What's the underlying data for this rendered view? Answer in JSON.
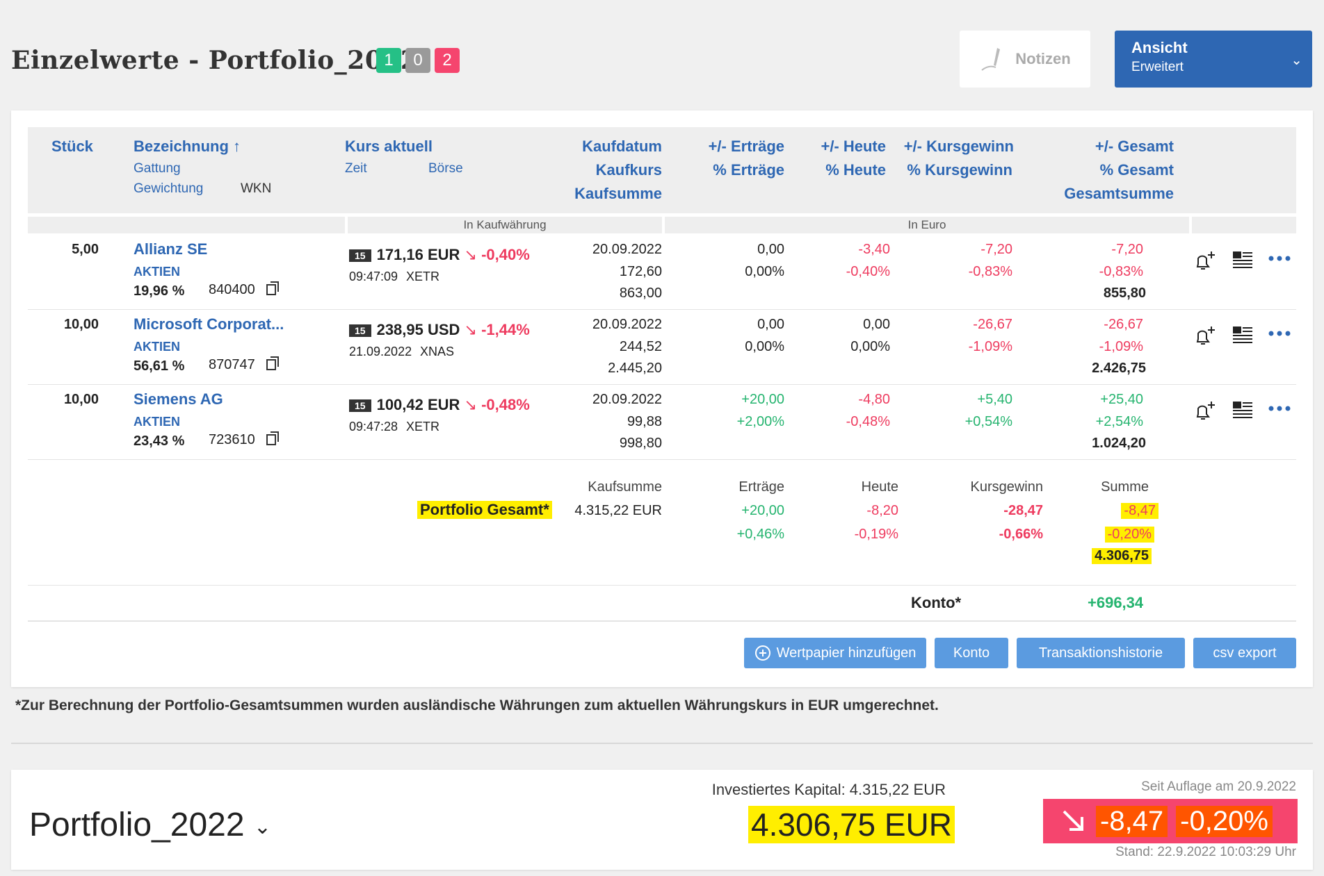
{
  "header": {
    "title": "Einzelwerte - Portfolio_2022",
    "badges": [
      "1",
      "0",
      "2"
    ],
    "notes_label": "Notizen",
    "view_label": "Ansicht",
    "view_value": "Erweitert"
  },
  "columns": {
    "stueck": "Stück",
    "bezeichnung": "Bezeichnung ↑",
    "gattung": "Gattung",
    "gewichtung": "Gewichtung",
    "wkn": "WKN",
    "kurs": "Kurs aktuell",
    "zeit": "Zeit",
    "boerse": "Börse",
    "kaufdatum": "Kaufdatum",
    "kaufkurs": "Kaufkurs",
    "kaufsumme": "Kaufsumme",
    "ertraege": "+/- Erträge",
    "pct_ertraege": "% Erträge",
    "heute": "+/- Heute",
    "pct_heute": "% Heute",
    "kursgewinn": "+/- Kursgewinn",
    "pct_kursgewinn": "% Kursgewinn",
    "gesamt": "+/- Gesamt",
    "pct_gesamt": "% Gesamt",
    "gesamtsumme": "Gesamtsumme",
    "in_kaufwaehrung": "In Kaufwährung",
    "in_euro": "In Euro"
  },
  "rows": [
    {
      "stueck": "5,00",
      "name": "Allianz SE",
      "gattung": "AKTIEN",
      "gewichtung": "19,96 %",
      "wkn": "840400",
      "tag": "15",
      "kurs": "171,16 EUR",
      "kurs_pct": "-0,40%",
      "zeit": "09:47:09",
      "boerse": "XETR",
      "kaufdatum": "20.09.2022",
      "kaufkurs": "172,60",
      "kaufsumme": "863,00",
      "ertraege": "0,00",
      "pct_ertraege": "0,00%",
      "heute": "-3,40",
      "pct_heute": "-0,40%",
      "kursgewinn": "-7,20",
      "pct_kursgewinn": "-0,83%",
      "gesamt": "-7,20",
      "pct_gesamt": "-0,83%",
      "gesamtsumme": "855,80"
    },
    {
      "stueck": "10,00",
      "name": "Microsoft Corporat...",
      "gattung": "AKTIEN",
      "gewichtung": "56,61 %",
      "wkn": "870747",
      "tag": "15",
      "kurs": "238,95 USD",
      "kurs_pct": "-1,44%",
      "zeit": "21.09.2022",
      "boerse": "XNAS",
      "kaufdatum": "20.09.2022",
      "kaufkurs": "244,52",
      "kaufsumme": "2.445,20",
      "ertraege": "0,00",
      "pct_ertraege": "0,00%",
      "heute": "0,00",
      "pct_heute": "0,00%",
      "kursgewinn": "-26,67",
      "pct_kursgewinn": "-1,09%",
      "gesamt": "-26,67",
      "pct_gesamt": "-1,09%",
      "gesamtsumme": "2.426,75"
    },
    {
      "stueck": "10,00",
      "name": "Siemens AG",
      "gattung": "AKTIEN",
      "gewichtung": "23,43 %",
      "wkn": "723610",
      "tag": "15",
      "kurs": "100,42 EUR",
      "kurs_pct": "-0,48%",
      "zeit": "09:47:28",
      "boerse": "XETR",
      "kaufdatum": "20.09.2022",
      "kaufkurs": "99,88",
      "kaufsumme": "998,80",
      "ertraege": "+20,00",
      "pct_ertraege": "+2,00%",
      "heute": "-4,80",
      "pct_heute": "-0,48%",
      "kursgewinn": "+5,40",
      "pct_kursgewinn": "+0,54%",
      "gesamt": "+25,40",
      "pct_gesamt": "+2,54%",
      "gesamtsumme": "1.024,20"
    }
  ],
  "totals": {
    "label": "Portfolio Gesamt*",
    "h_kaufsumme": "Kaufsumme",
    "h_ertraege": "Erträge",
    "h_heute": "Heute",
    "h_kursgewinn": "Kursgewinn",
    "h_summe": "Summe",
    "kaufsumme": "4.315,22 EUR",
    "ertraege": "+20,00",
    "pct_ertraege": "+0,46%",
    "heute": "-8,20",
    "pct_heute": "-0,19%",
    "kursgewinn": "-28,47",
    "pct_kursgewinn": "-0,66%",
    "summe": "-8,47",
    "pct_summe": "-0,20%",
    "gesamt": "4.306,75",
    "konto_label": "Konto*",
    "konto_value": "+696,34"
  },
  "actions": {
    "add": "Wertpapier hinzufügen",
    "konto": "Konto",
    "history": "Transaktionshistorie",
    "csv": "csv export"
  },
  "footnote": "*Zur Berechnung der Portfolio-Gesamtsummen wurden ausländische Währungen zum aktuellen Währungskurs in EUR umgerechnet.",
  "summary": {
    "name": "Portfolio_2022",
    "invested": "Investiertes Kapital: 4.315,22 EUR",
    "value": "4.306,75 EUR",
    "since": "Seit Auflage am 20.9.2022",
    "change": "-8,47",
    "change_pct": "-0,20%",
    "stand": "Stand: 22.9.2022 10:03:29 Uhr"
  },
  "colors": {
    "accent": "#2e67b3",
    "negative": "#ee3b5f",
    "positive": "#25b46f",
    "highlight": "#ffee00"
  }
}
